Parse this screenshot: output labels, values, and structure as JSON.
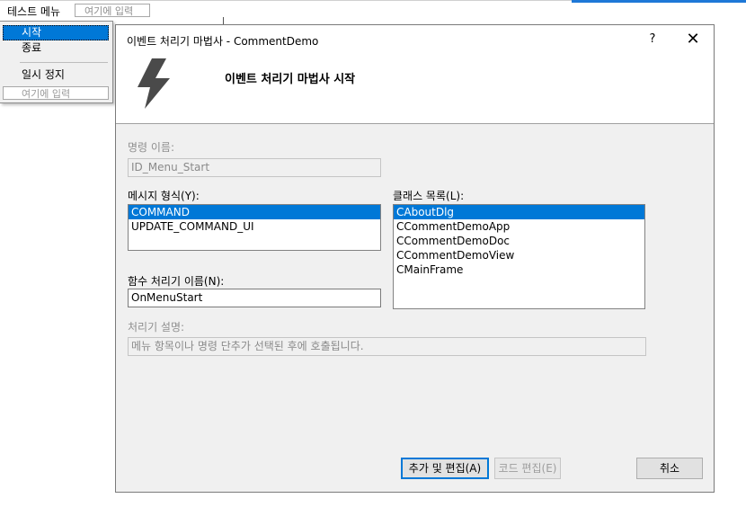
{
  "menubar": {
    "title": "테스트 메뉴",
    "input_placeholder": "여기에 입력"
  },
  "dropdown": {
    "items": [
      {
        "label": "시작",
        "selected": true
      },
      {
        "label": "종료",
        "selected": false
      },
      {
        "label": "일시 정지",
        "selected": false
      }
    ],
    "input_placeholder": "여기에 입력"
  },
  "dialog": {
    "title": "이벤트 처리기 마법사 - CommentDemo",
    "help_label": "?",
    "close_label": "✕",
    "header_title": "이벤트 처리기 마법사 시작",
    "command_name_label": "명령 이름:",
    "command_name_value": "ID_Menu_Start",
    "message_type_label": "메시지 형식(Y):",
    "message_types": [
      "COMMAND",
      "UPDATE_COMMAND_UI"
    ],
    "message_type_selected": "COMMAND",
    "class_list_label": "클래스 목록(L):",
    "classes": [
      "CAboutDlg",
      "CCommentDemoApp",
      "CCommentDemoDoc",
      "CCommentDemoView",
      "CMainFrame"
    ],
    "class_selected": "CAboutDlg",
    "function_name_label": "함수 처리기 이름(N):",
    "function_name_value": "OnMenuStart",
    "description_label": "처리기 설명:",
    "description_value": "메뉴 항목이나 명령 단추가 선택된 후에 호출됩니다.",
    "buttons": {
      "add_edit": "추가 및 편집(A)",
      "edit_code": "코드 편집(E)",
      "cancel": "취소"
    }
  },
  "colors": {
    "selection": "#0078d7",
    "dialog_bg": "#f0f0f0"
  }
}
